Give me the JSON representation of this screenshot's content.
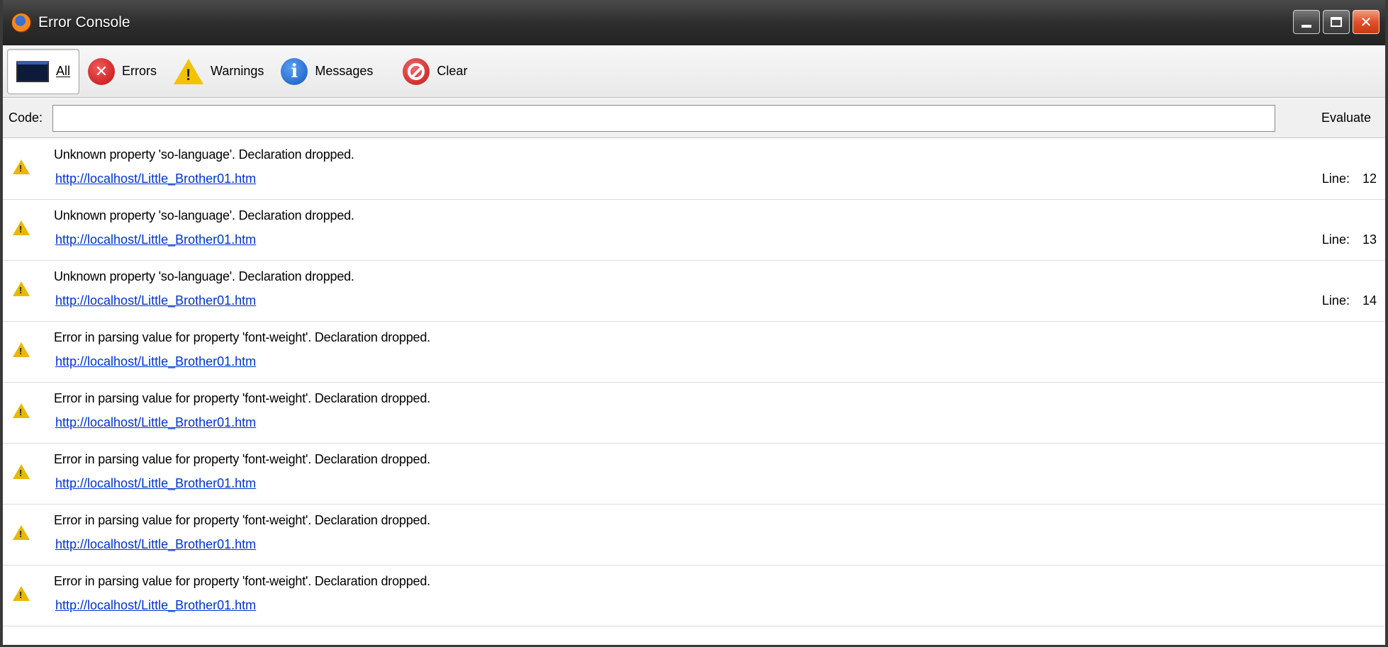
{
  "window": {
    "title": "Error Console",
    "controls": {
      "minimize": "minimize",
      "maximize": "maximize",
      "close": "✕"
    }
  },
  "toolbar": {
    "all_label": "All",
    "errors_label": "Errors",
    "warnings_label": "Warnings",
    "messages_label": "Messages",
    "clear_label": "Clear",
    "info_glyph": "i",
    "error_glyph": "✕",
    "warn_glyph": "!"
  },
  "codebar": {
    "label": "Code:",
    "value": "",
    "evaluate_label": "Evaluate"
  },
  "messages": [
    {
      "text": "Unknown property 'so-language'.  Declaration dropped.",
      "link": "http://localhost/Little_Brother01.htm",
      "line_label": "Line:",
      "line": "12",
      "icon": "warning-icon"
    },
    {
      "text": "Unknown property 'so-language'.  Declaration dropped.",
      "link": "http://localhost/Little_Brother01.htm",
      "line_label": "Line:",
      "line": "13",
      "icon": "warning-icon"
    },
    {
      "text": "Unknown property 'so-language'.  Declaration dropped.",
      "link": "http://localhost/Little_Brother01.htm",
      "line_label": "Line:",
      "line": "14",
      "icon": "warning-icon"
    },
    {
      "text": "Error in parsing value for property 'font-weight'.  Declaration dropped.",
      "link": "http://localhost/Little_Brother01.htm",
      "icon": "warning-icon"
    },
    {
      "text": "Error in parsing value for property 'font-weight'.  Declaration dropped.",
      "link": "http://localhost/Little_Brother01.htm",
      "icon": "warning-icon"
    },
    {
      "text": "Error in parsing value for property 'font-weight'.  Declaration dropped.",
      "link": "http://localhost/Little_Brother01.htm",
      "icon": "warning-icon"
    },
    {
      "text": "Error in parsing value for property 'font-weight'.  Declaration dropped.",
      "link": "http://localhost/Little_Brother01.htm",
      "icon": "warning-icon"
    },
    {
      "text": "Error in parsing value for property 'font-weight'.  Declaration dropped.",
      "link": "http://localhost/Little_Brother01.htm",
      "icon": "warning-icon"
    }
  ],
  "colors": {
    "link": "#0033cc",
    "warning": "#e8b800",
    "error": "#c21010",
    "info": "#1258c2",
    "titlebar": "#2e2e2e",
    "close_button": "#e0502a"
  }
}
